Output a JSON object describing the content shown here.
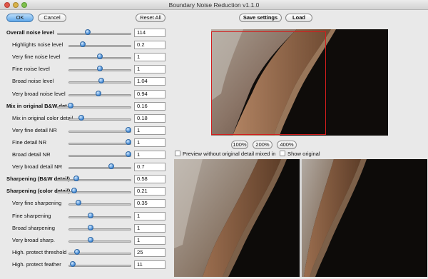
{
  "window": {
    "title": "Boundary Noise Reduction v1.1.0"
  },
  "buttons": {
    "ok": "OK",
    "cancel": "Cancel",
    "reset_all": "Reset All",
    "save_settings": "Save settings",
    "load": "Load"
  },
  "sliders": [
    {
      "label": "Overall noise level",
      "value": "114",
      "level": 0.41,
      "bold": true
    },
    {
      "label": "Highlights noise level",
      "value": "0.2",
      "level": 0.2,
      "bold": false
    },
    {
      "label": "Very fine noise level",
      "value": "1",
      "level": 0.5,
      "bold": false
    },
    {
      "label": "Fine noise level",
      "value": "1",
      "level": 0.5,
      "bold": false
    },
    {
      "label": "Broad noise level",
      "value": "1.04",
      "level": 0.52,
      "bold": false
    },
    {
      "label": "Very broad noise level",
      "value": "0.94",
      "level": 0.47,
      "bold": false
    },
    {
      "label": "Mix in original B&W det.",
      "value": "0.16",
      "level": 0.16,
      "bold": true
    },
    {
      "label": "Mix in original color detail",
      "value": "0.18",
      "level": 0.18,
      "bold": false
    },
    {
      "label": "Very fine detail NR",
      "value": "1",
      "level": 1.0,
      "bold": false
    },
    {
      "label": "Fine detail NR",
      "value": "1",
      "level": 1.0,
      "bold": false
    },
    {
      "label": "Broad detail NR",
      "value": "1",
      "level": 1.0,
      "bold": false
    },
    {
      "label": "Very broad detail NR",
      "value": "0.7",
      "level": 0.7,
      "bold": false
    },
    {
      "label": "Sharpening (B&W detail)",
      "value": "0.58",
      "level": 0.24,
      "bold": true
    },
    {
      "label": "Sharpening (color detail)",
      "value": "0.21",
      "level": 0.21,
      "bold": true
    },
    {
      "label": "Very fine sharpening",
      "value": "0.35",
      "level": 0.12,
      "bold": false
    },
    {
      "label": "Fine sharpening",
      "value": "1",
      "level": 0.34,
      "bold": false
    },
    {
      "label": "Broad sharpening",
      "value": "1",
      "level": 0.34,
      "bold": false
    },
    {
      "label": "Very broad sharp.",
      "value": "1",
      "level": 0.34,
      "bold": false
    },
    {
      "label": "High. protect threshold",
      "value": "25",
      "level": 0.1,
      "bold": false
    },
    {
      "label": "High. protect feather",
      "value": "11",
      "level": 0.03,
      "bold": false
    }
  ],
  "zoom": {
    "z100": "100%",
    "z200": "200%",
    "z400": "400%"
  },
  "options": {
    "preview_without_original": "Preview without original detail mixed in",
    "show_original": "Show original"
  },
  "colors": {
    "accent": "#3f86d2",
    "selection_box": "#d21d1d",
    "preview_dark": "#0d0b09"
  }
}
